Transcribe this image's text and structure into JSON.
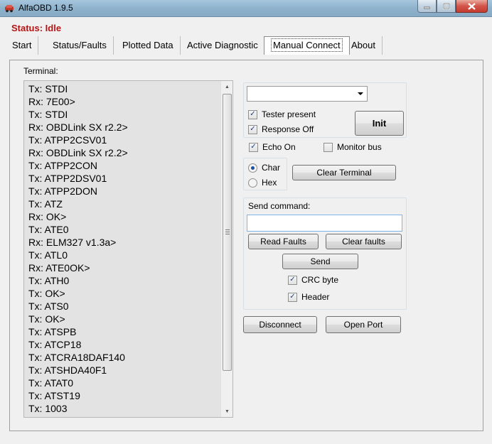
{
  "window": {
    "title": "AlfaOBD 1.9.5"
  },
  "status": "Status: Idle",
  "tabs": [
    "Start",
    "Status/Faults",
    "Plotted Data",
    "Active Diagnostic",
    "Manual Connect",
    "About"
  ],
  "active_tab": "Manual Connect",
  "terminal": {
    "label": "Terminal:",
    "lines": [
      "Tx: STDI",
      "Rx: 7E00>",
      "Tx: STDI",
      "Rx: OBDLink SX r2.2>",
      "Tx: ATPP2CSV01",
      "Rx: OBDLink SX r2.2>",
      "Tx: ATPP2CON",
      "Tx: ATPP2DSV01",
      "Tx: ATPP2DON",
      "Tx: ATZ",
      "Rx: OK>",
      "Tx: ATE0",
      "Rx: ELM327 v1.3a>",
      "Tx: ATL0",
      "Rx: ATE0OK>",
      "Tx: ATH0",
      "Tx: OK>",
      "Tx: ATS0",
      "Tx: OK>",
      "Tx: ATSPB",
      "Tx: ATCP18",
      "Tx: ATCRA18DAF140",
      "Tx: ATSHDA40F1",
      "Tx: ATAT0",
      "Tx: ATST19",
      "Tx: 1003"
    ]
  },
  "connect": {
    "port_value": "",
    "tester_present": "Tester present",
    "response_off": "Response Off",
    "init": "Init",
    "echo_on": "Echo On",
    "monitor_bus": "Monitor bus",
    "char": "Char",
    "hex": "Hex",
    "clear_terminal": "Clear Terminal"
  },
  "command": {
    "label": "Send command:",
    "value": "",
    "read_faults": "Read Faults",
    "clear_faults": "Clear faults",
    "send": "Send",
    "crc_byte": "CRC byte",
    "header": "Header"
  },
  "bottom": {
    "disconnect": "Disconnect",
    "open_port": "Open Port"
  },
  "checks": {
    "tester_present": true,
    "response_off": true,
    "echo_on": true,
    "monitor_bus": false,
    "crc_byte": true,
    "header": true
  },
  "mode": "Char",
  "colors": {
    "status": "#b31515",
    "titlebar": "#8fb2cc",
    "close_button": "#c43b2e"
  }
}
